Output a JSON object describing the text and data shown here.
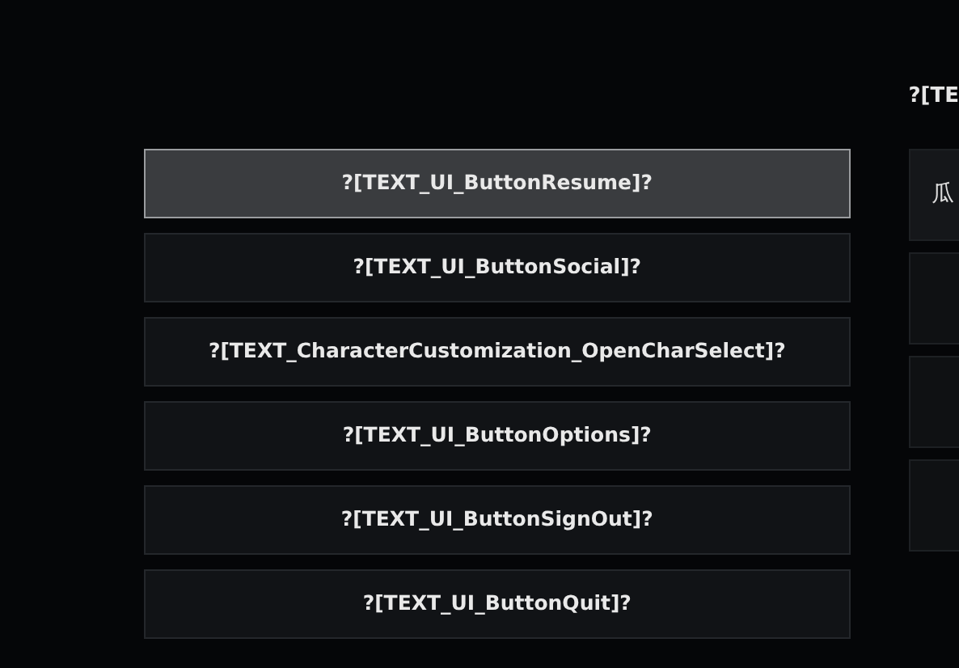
{
  "menu": [
    {
      "label": "?[TEXT_UI_ButtonResume]?",
      "selected": true
    },
    {
      "label": "?[TEXT_UI_ButtonSocial]?",
      "selected": false
    },
    {
      "label": "?[TEXT_CharacterCustomization_OpenCharSelect]?",
      "selected": false
    },
    {
      "label": "?[TEXT_UI_ButtonOptions]?",
      "selected": false
    },
    {
      "label": "?[TEXT_UI_ButtonSignOut]?",
      "selected": false
    },
    {
      "label": "?[TEXT_UI_ButtonQuit]?",
      "selected": false
    }
  ],
  "side_panel": {
    "heading": "?[TE",
    "slots": [
      {
        "kind": "labeled",
        "label": "瓜"
      },
      {
        "kind": "blank"
      },
      {
        "kind": "blank"
      },
      {
        "kind": "blank"
      }
    ]
  }
}
